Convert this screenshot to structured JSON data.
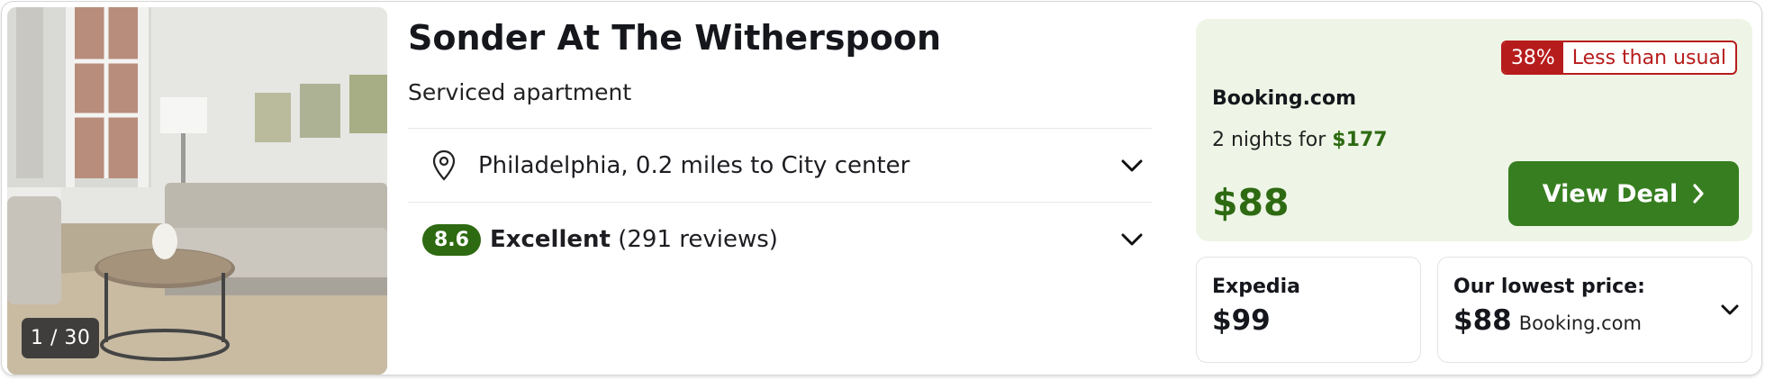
{
  "photo": {
    "counter": "1 / 30"
  },
  "hotel": {
    "name": "Sonder At The Witherspoon",
    "type": "Serviced apartment",
    "location": "Philadelphia, 0.2 miles to City center",
    "score": "8.6",
    "rating_label": "Excellent",
    "reviews": "(291 reviews)"
  },
  "deal": {
    "badge_pct": "38%",
    "badge_text": "Less than usual",
    "provider": "Booking.com",
    "nights_prefix": "2 nights for",
    "nights_total": "$177",
    "price": "$88",
    "button_label": "View Deal",
    "accent": "#2e6a12"
  },
  "alt": {
    "provider": "Expedia",
    "price": "$99"
  },
  "lowest": {
    "label": "Our lowest price:",
    "price": "$88",
    "provider": "Booking.com"
  },
  "icons": [
    "location-pin-icon",
    "chevron-down-icon",
    "chevron-right-icon"
  ]
}
